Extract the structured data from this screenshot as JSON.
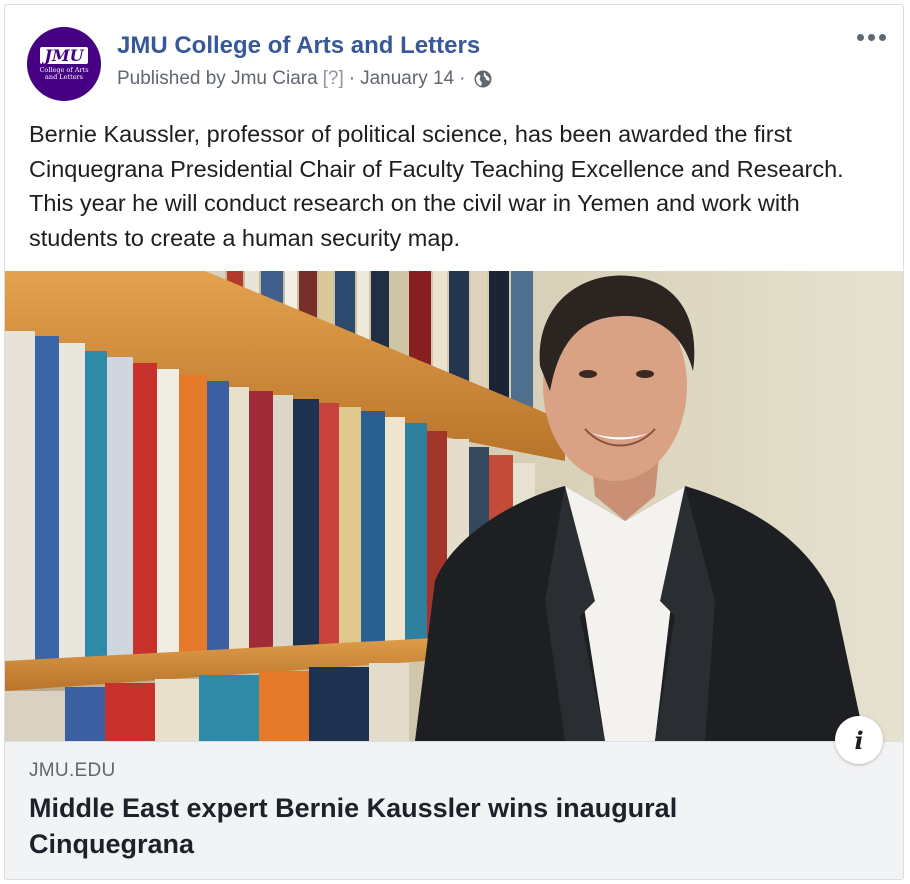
{
  "post": {
    "page_name": "JMU College of Arts and Letters",
    "avatar": {
      "logo_text": "JMU",
      "logo_subtext": "College of Arts and Letters"
    },
    "published_by": "Published by Jmu Ciara",
    "help_marker": "[?]",
    "separator": "·",
    "date": "January 14",
    "separator_2": "·",
    "privacy_icon": "globe-icon",
    "more_icon": "ellipsis-icon",
    "body": "Bernie Kaussler, professor of political science, has been awarded the first Cinquegrana Presidential Chair of Faculty Teaching Excellence and Research. This year he will conduct research on the civil war in Yemen and work with students to create a human security map."
  },
  "link_preview": {
    "image_subject": "Man in dark blazer smiling in front of bookshelves",
    "info_icon": "info-icon",
    "info_glyph": "i",
    "domain": "JMU.EDU",
    "title": "Middle East expert Bernie Kaussler wins inaugural Cinquegrana"
  },
  "colors": {
    "page_name": "#385898",
    "brand_purple": "#450084",
    "meta_text": "#606770",
    "body_text": "#1c1e21",
    "preview_bg": "#f2f3f5"
  }
}
